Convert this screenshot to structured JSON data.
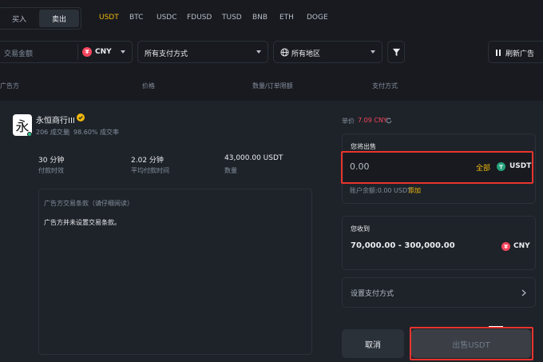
{
  "toggle": {
    "buy": "买入",
    "sell": "卖出"
  },
  "assets": [
    "USDT",
    "BTC",
    "USDC",
    "FDUSD",
    "TUSD",
    "BNB",
    "ETH",
    "DOGE"
  ],
  "filters": {
    "amount_placeholder": "交易金额",
    "currency": "CNY",
    "payment": "所有支付方式",
    "region": "所有地区",
    "refresh": "刷新广告"
  },
  "table_header": {
    "advertiser": "广告方",
    "price": "价格",
    "quantity_limit": "数量/订单限额",
    "payment": "支付方式"
  },
  "merchant": {
    "avatar_char": "永",
    "name": "永恒商行III",
    "trades": "206 成交量",
    "completion": "98.60% 成交率",
    "stats": [
      {
        "value": "30 分钟",
        "label": "付款时效"
      },
      {
        "value": "2.02 分钟",
        "label": "平均付款时间"
      },
      {
        "value": "43,000.00 USDT",
        "label": "数量"
      }
    ],
    "terms_title": "广告方交易条款（请仔细阅读）",
    "terms_text": "广告方并未设置交易条款。"
  },
  "order": {
    "price_label": "单价",
    "price_value": "7.09 CNY",
    "sell_label": "您将出售",
    "sell_value": "0.00",
    "all_label": "全部",
    "sell_asset": "USDT",
    "balance_text": "账户余额:0.00 USDT",
    "add_label": "添加",
    "receive_label": "您收到",
    "receive_range": "70,000.00 - 300,000.00",
    "receive_currency": "CNY",
    "payment_setup": "设置支付方式",
    "cancel": "取消",
    "submit": "出售USDT"
  },
  "colors": {
    "accent": "#f0b90b",
    "red": "#f6465d",
    "teal": "#2ebd85"
  }
}
